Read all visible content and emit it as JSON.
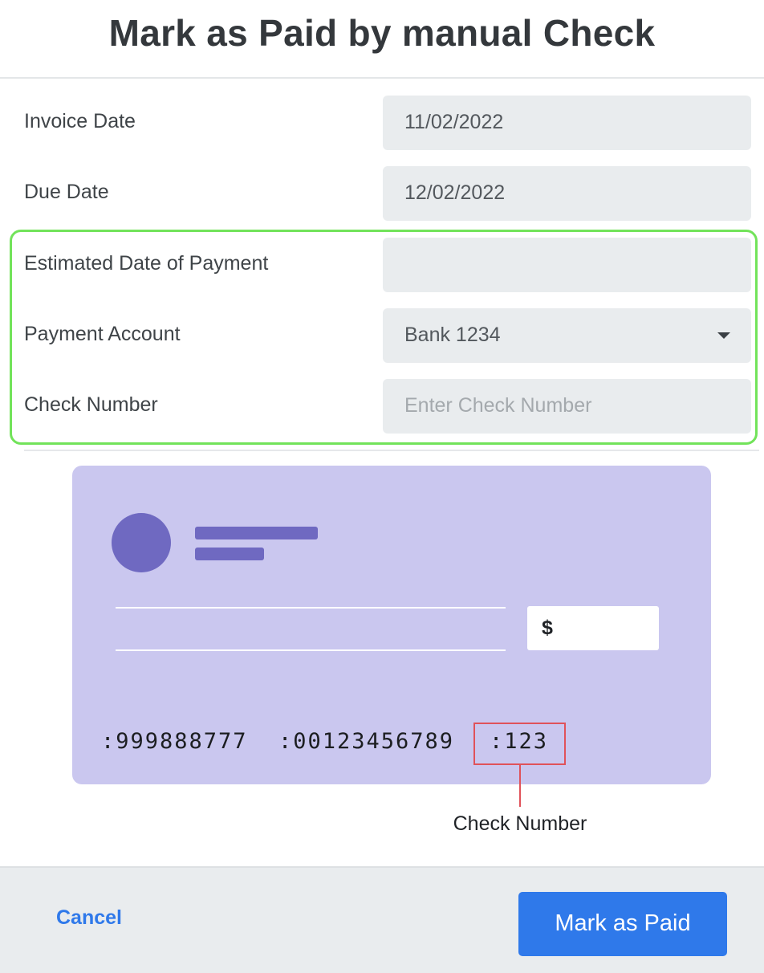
{
  "dialog": {
    "title": "Mark as Paid by manual Check"
  },
  "form": {
    "invoice_date": {
      "label": "Invoice Date",
      "value": "11/02/2022"
    },
    "due_date": {
      "label": "Due Date",
      "value": "12/02/2022"
    },
    "estimated_payment_date": {
      "label": "Estimated Date of Payment",
      "value": ""
    },
    "payment_account": {
      "label": "Payment Account",
      "selected": "Bank 1234",
      "icon": "chevron-down-icon"
    },
    "check_number": {
      "label": "Check Number",
      "value": "",
      "placeholder": "Enter Check Number"
    }
  },
  "check_illustration": {
    "currency_symbol": "$",
    "routing_number": ":999888777",
    "account_number": ":00123456789",
    "check_number": ":123",
    "callout_label": "Check Number",
    "colors": {
      "background": "#cac7ef",
      "accent": "#6f69c1",
      "highlight": "#e0525a"
    }
  },
  "footer": {
    "cancel_label": "Cancel",
    "submit_label": "Mark as Paid"
  },
  "colors": {
    "primary": "#2f79ea",
    "focus_outline": "#72e35a",
    "field_background": "#e9ecee"
  }
}
